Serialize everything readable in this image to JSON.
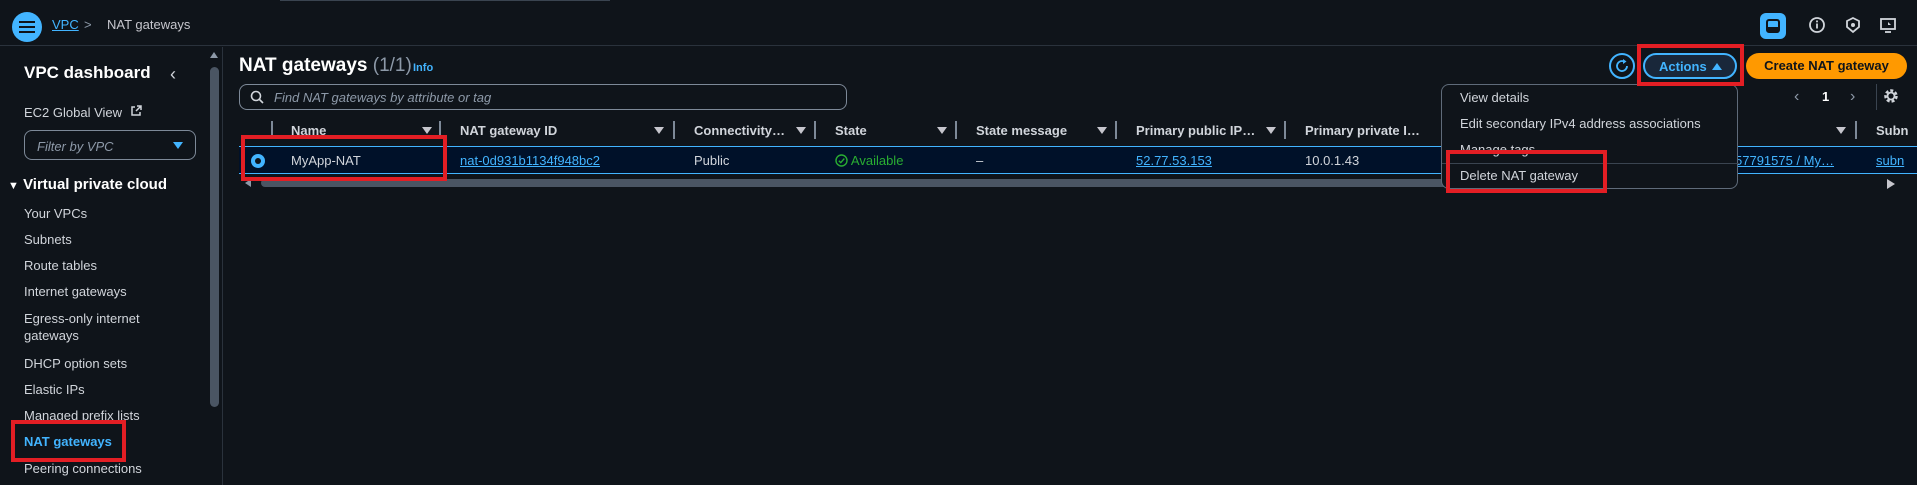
{
  "breadcrumb": {
    "service": "VPC",
    "separator": ">",
    "current": "NAT gateways"
  },
  "sidebar": {
    "title": "VPC dashboard",
    "ec2_link": "EC2 Global View",
    "filter_placeholder": "Filter by VPC",
    "section": "Virtual private cloud",
    "items": [
      {
        "label": "Your VPCs"
      },
      {
        "label": "Subnets"
      },
      {
        "label": "Route tables"
      },
      {
        "label": "Internet gateways"
      },
      {
        "label": "Egress-only internet"
      },
      {
        "label": "gateways"
      },
      {
        "label": "DHCP option sets"
      },
      {
        "label": "Elastic IPs"
      },
      {
        "label": "Managed prefix lists"
      },
      {
        "label": "NAT gateways"
      },
      {
        "label": "Peering connections"
      }
    ]
  },
  "main": {
    "title": "NAT gateways",
    "count": "(1/1)",
    "info": "Info",
    "search_placeholder": "Find NAT gateways by attribute or tag",
    "actions_label": "Actions",
    "create_label": "Create NAT gateway",
    "page_number": "1"
  },
  "table": {
    "columns": [
      "Name",
      "NAT gateway ID",
      "Connectivity…",
      "State",
      "State message",
      "Primary public IP…",
      "Primary private I…",
      "Subn"
    ],
    "row": {
      "name": "MyApp-NAT",
      "id": "nat-0d931b1134f948bc2",
      "connectivity": "Public",
      "state": "Available",
      "state_message": "–",
      "public_ip": "52.77.53.153",
      "private_ip": "10.0.1.43",
      "vpc_partial": "57791575 / My…",
      "subnet_partial": "subn"
    }
  },
  "actions_menu": {
    "items": [
      "View details",
      "Edit secondary IPv4 address associations",
      "Manage tags",
      "Delete NAT gateway"
    ]
  },
  "colors": {
    "accent": "#42b4ff",
    "primary_button": "#ff9900",
    "highlight": "#e31e24",
    "success": "#29ad32",
    "background": "#0f141a"
  }
}
